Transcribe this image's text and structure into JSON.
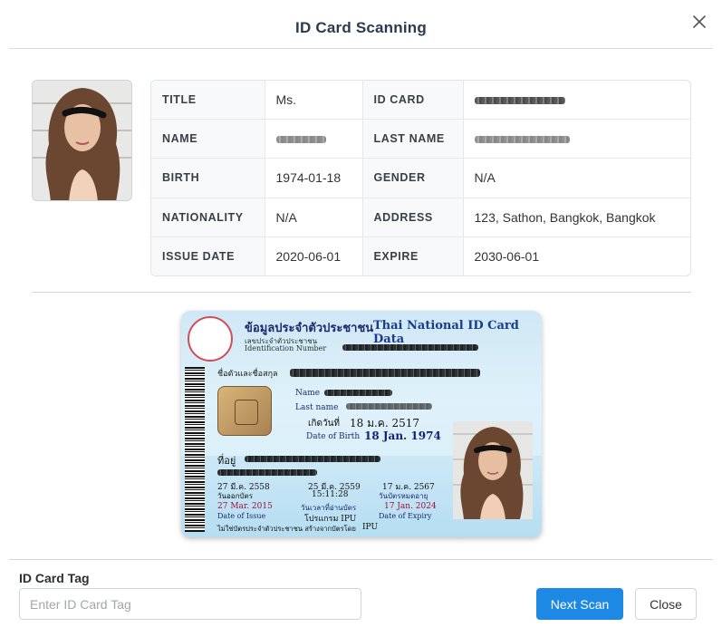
{
  "dialog": {
    "title": "ID Card Scanning"
  },
  "info": {
    "rows": [
      {
        "label1": "TITLE",
        "value1": "Ms.",
        "label2": "ID CARD",
        "value2": ""
      },
      {
        "label1": "NAME",
        "value1": "",
        "label2": "LAST NAME",
        "value2": ""
      },
      {
        "label1": "BIRTH",
        "value1": "1974-01-18",
        "label2": "GENDER",
        "value2": "N/A"
      },
      {
        "label1": "NATIONALITY",
        "value1": "N/A",
        "label2": "ADDRESS",
        "value2": "123, Sathon, Bangkok, Bangkok"
      },
      {
        "label1": "ISSUE DATE",
        "value1": "2020-06-01",
        "label2": "EXPIRE",
        "value2": "2030-06-01"
      }
    ]
  },
  "card": {
    "header_th": "ข้อมูลประจำตัวประชาชน",
    "header_en": "Thai National ID Card Data",
    "id_label_th": "เลขประจำตัวประชาชน",
    "id_label_en": "Identification Number",
    "name_th_label": "ชื่อตัวและชื่อสกุล",
    "name_label": "Name",
    "lastname_label": "Last name",
    "birth_th_label": "เกิดวันที่",
    "birth_th_value": "18 ม.ค. 2517",
    "birth_en_label": "Date of Birth",
    "birth_en_value": "18 Jan. 1974",
    "address_label": "ที่อยู่",
    "issue_th": "27 มี.ค. 2558",
    "issue_th_label": "วันออกบัตร",
    "issue_en": "27 Mar. 2015",
    "issue_en_label": "Date of Issue",
    "mid_th": "25 มี.ค. 2559",
    "mid_time": "15:11:28",
    "mid_label_th": "วันเวลาที่อ่านบัตร",
    "mid_label_en": "โปรแกรม IPU",
    "expiry_th": "17 ม.ค. 2567",
    "expiry_th_label": "วันบัตรหมดอายุ",
    "expiry_en": "17 Jan. 2024",
    "expiry_en_label": "Date of Expiry",
    "footer_text": "ไม่ใช่บัตรประจำตัวประชาชน สร้างจากบัตรโดย",
    "footer_tag": "IPU"
  },
  "footer": {
    "tag_label": "ID Card Tag",
    "tag_placeholder": "Enter ID Card Tag",
    "tag_value": "",
    "next_button": "Next Scan",
    "close_button": "Close"
  },
  "colors": {
    "primary": "#1e88e5",
    "title": "#2b3a4f",
    "card_blue": "#1a3b8c"
  }
}
